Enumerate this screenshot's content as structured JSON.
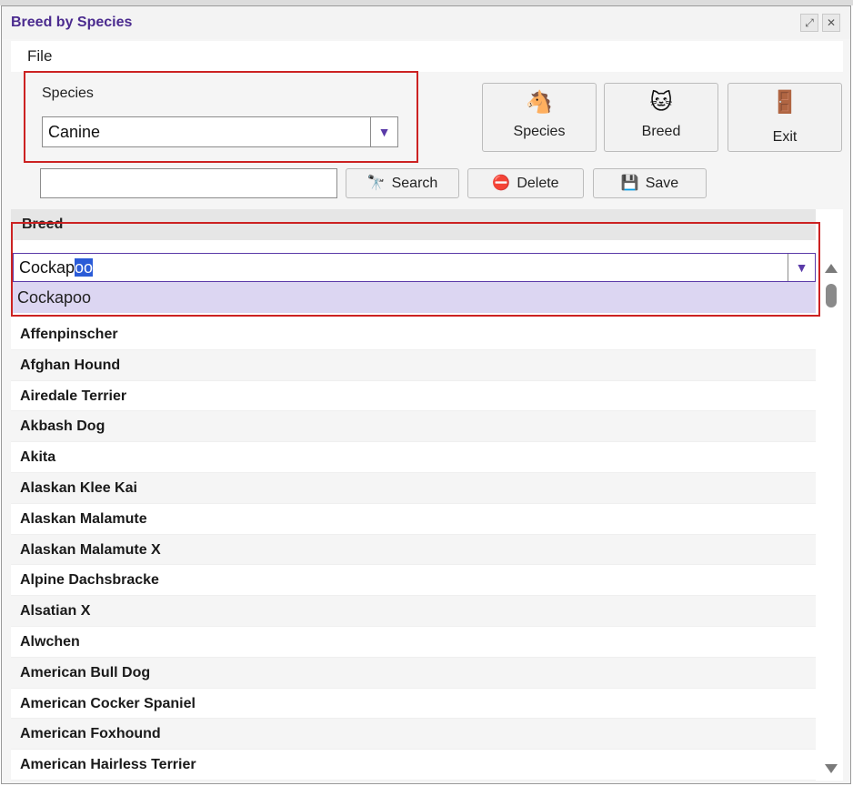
{
  "window": {
    "title": "Breed by Species"
  },
  "menu": {
    "file": "File"
  },
  "species": {
    "label": "Species",
    "selected": "Canine"
  },
  "buttons": {
    "species": "Species",
    "breed": "Breed",
    "exit": "Exit",
    "search": "Search",
    "delete": "Delete",
    "save": "Save"
  },
  "search": {
    "value": "",
    "placeholder": ""
  },
  "grid": {
    "header": "Breed",
    "filter": {
      "typed": "Cockap",
      "autocomplete": "oo"
    },
    "suggestion": "Cockapoo",
    "rows": [
      "Affenpinscher",
      "Afghan Hound",
      "Airedale Terrier",
      "Akbash Dog",
      "Akita",
      "Alaskan Klee Kai",
      "Alaskan Malamute",
      "Alaskan Malamute X",
      "Alpine Dachsbracke",
      "Alsatian X",
      "Alwchen",
      "American Bull Dog",
      "American Cocker Spaniel",
      "American Foxhound",
      "American Hairless Terrier"
    ]
  },
  "icons": {
    "species": "horse-icon",
    "breed": "cat-icon",
    "exit": "exit-door-icon",
    "search": "binoculars-icon",
    "delete": "delete-icon",
    "save": "floppy-disk-icon"
  },
  "colors": {
    "title": "#4b2b8f",
    "highlight": "#cc2222",
    "selection": "#2a5bd7",
    "suggestion_bg": "#dcd6f2"
  }
}
